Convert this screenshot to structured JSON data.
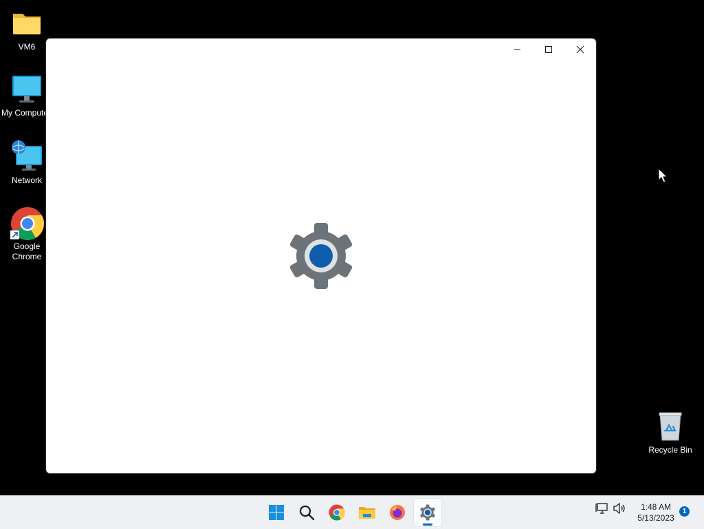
{
  "desktop": {
    "icons": [
      {
        "label": "VM6"
      },
      {
        "label": "My Computer"
      },
      {
        "label": "Network"
      },
      {
        "label": "Google Chrome"
      },
      {
        "label": "Recycle Bin"
      }
    ]
  },
  "window": {
    "controls": [
      "minimize-icon",
      "maximize-icon",
      "close-icon"
    ],
    "splash_icon": "settings-gear-icon",
    "colors": {
      "gear": "#6d7479",
      "hub": "#0f5dab"
    }
  },
  "taskbar": {
    "apps": [
      {
        "name": "start-icon"
      },
      {
        "name": "search-icon"
      },
      {
        "name": "chrome-icon"
      },
      {
        "name": "file-explorer-icon"
      },
      {
        "name": "firefox-icon"
      },
      {
        "name": "settings-icon",
        "active": true
      }
    ],
    "tray": {
      "time": "1:48 AM",
      "date": "5/13/2023",
      "notification_count": "1"
    }
  }
}
